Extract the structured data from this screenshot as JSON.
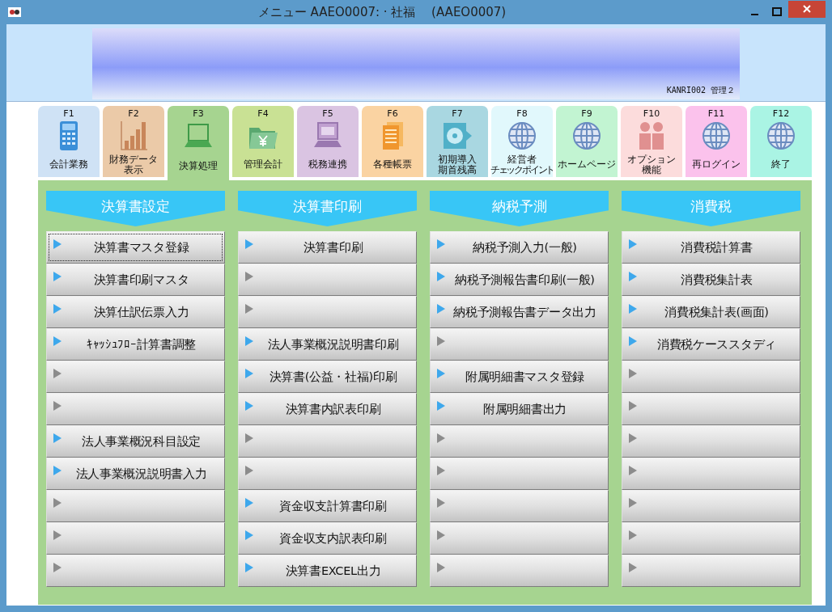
{
  "window": {
    "title": "メニュー AAEO0007: · 社福　 (AAEO0007)"
  },
  "banner": {
    "user": "KANRI002 管理２"
  },
  "function_keys": [
    {
      "key": "F1",
      "label": "会計業務",
      "color": "#cfe2f5",
      "selected": false
    },
    {
      "key": "F2",
      "label_lines": [
        "財務データ",
        "表示"
      ],
      "color": "#ebcaa8",
      "selected": false
    },
    {
      "key": "F3",
      "label": "決算処理",
      "color": "#a6d490",
      "selected": true
    },
    {
      "key": "F4",
      "label": "管理会計",
      "color": "#c9e194",
      "selected": false
    },
    {
      "key": "F5",
      "label": "税務連携",
      "color": "#dac4e2",
      "selected": false
    },
    {
      "key": "F6",
      "label": "各種帳票",
      "color": "#fad3a2",
      "selected": false
    },
    {
      "key": "F7",
      "label_lines": [
        "初期導入",
        "期首残高"
      ],
      "color": "#a9d7e1",
      "selected": false
    },
    {
      "key": "F8",
      "label_lines": [
        "経営者",
        "チェックポイント"
      ],
      "color": "#e1f8fc",
      "selected": false
    },
    {
      "key": "F9",
      "label": "ホームページ",
      "color": "#c2f4d2",
      "selected": false
    },
    {
      "key": "F10",
      "label_lines": [
        "オプション",
        "機能"
      ],
      "color": "#fcdcdc",
      "selected": false
    },
    {
      "key": "F11",
      "label": "再ログイン",
      "color": "#fbc2ec",
      "selected": false
    },
    {
      "key": "F12",
      "label": "終了",
      "color": "#aaf4e4",
      "selected": false
    }
  ],
  "sections": [
    {
      "title": "決算書設定",
      "buttons": [
        {
          "label": "決算書マスタ登録",
          "enabled": true,
          "focused": true
        },
        {
          "label": "決算書印刷マスタ",
          "enabled": true,
          "focused": false
        },
        {
          "label": "決算仕訳伝票入力",
          "enabled": true,
          "focused": false
        },
        {
          "label": "ｷｬｯｼｭﾌﾛｰ計算書調整",
          "enabled": true,
          "focused": false
        },
        {
          "enabled": false,
          "focused": false
        },
        {
          "enabled": false,
          "focused": false
        },
        {
          "label": "法人事業概況科目設定",
          "enabled": true,
          "focused": false
        },
        {
          "label": "法人事業概況説明書入力",
          "enabled": true,
          "focused": false
        },
        {
          "enabled": false,
          "focused": false
        },
        {
          "enabled": false,
          "focused": false
        },
        {
          "enabled": false,
          "focused": false
        }
      ]
    },
    {
      "title": "決算書印刷",
      "buttons": [
        {
          "label": "決算書印刷",
          "enabled": true,
          "focused": false
        },
        {
          "enabled": false,
          "focused": false
        },
        {
          "enabled": false,
          "focused": false
        },
        {
          "label": "法人事業概況説明書印刷",
          "enabled": true,
          "focused": false
        },
        {
          "label": "決算書(公益・社福)印刷",
          "enabled": true,
          "focused": false
        },
        {
          "label": "決算書内訳表印刷",
          "enabled": true,
          "focused": false
        },
        {
          "enabled": false,
          "focused": false
        },
        {
          "enabled": false,
          "focused": false
        },
        {
          "label": "資金収支計算書印刷",
          "enabled": true,
          "focused": false
        },
        {
          "label": "資金収支内訳表印刷",
          "enabled": true,
          "focused": false
        },
        {
          "label": "決算書EXCEL出力",
          "enabled": true,
          "focused": false
        }
      ]
    },
    {
      "title": "納税予測",
      "buttons": [
        {
          "label": "納税予測入力(一般)",
          "enabled": true,
          "focused": false
        },
        {
          "label": "納税予測報告書印刷(一般)",
          "enabled": true,
          "focused": false
        },
        {
          "label": "納税予測報告書データ出力",
          "enabled": true,
          "focused": false
        },
        {
          "enabled": false,
          "focused": false
        },
        {
          "label": "附属明細書マスタ登録",
          "enabled": true,
          "focused": false
        },
        {
          "label": "附属明細書出力",
          "enabled": true,
          "focused": false
        },
        {
          "enabled": false,
          "focused": false
        },
        {
          "enabled": false,
          "focused": false
        },
        {
          "enabled": false,
          "focused": false
        },
        {
          "enabled": false,
          "focused": false
        },
        {
          "enabled": false,
          "focused": false
        }
      ]
    },
    {
      "title": "消費税",
      "buttons": [
        {
          "label": "消費税計算書",
          "enabled": true,
          "focused": false
        },
        {
          "label": "消費税集計表",
          "enabled": true,
          "focused": false
        },
        {
          "label": "消費税集計表(画面)",
          "enabled": true,
          "focused": false
        },
        {
          "label": "消費税ケーススタディ",
          "enabled": true,
          "focused": false
        },
        {
          "enabled": false,
          "focused": false
        },
        {
          "enabled": false,
          "focused": false
        },
        {
          "enabled": false,
          "focused": false
        },
        {
          "enabled": false,
          "focused": false
        },
        {
          "enabled": false,
          "focused": false
        },
        {
          "enabled": false,
          "focused": false
        },
        {
          "enabled": false,
          "focused": false
        }
      ]
    }
  ]
}
